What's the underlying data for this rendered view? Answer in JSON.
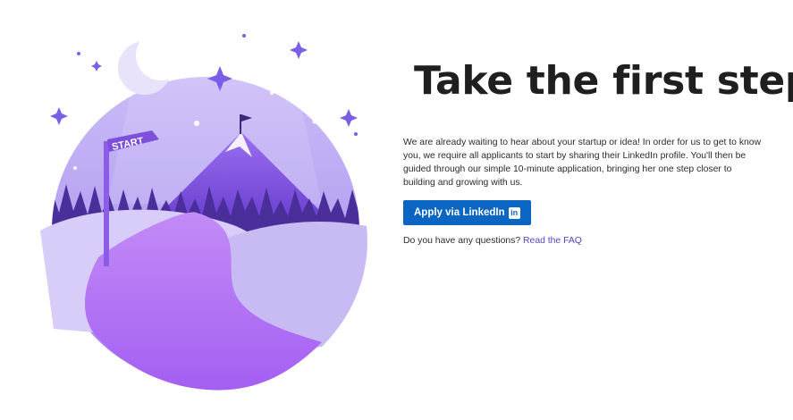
{
  "hero": {
    "title": "Take the first step",
    "description": "We are already waiting to hear about your startup or idea! In order for us to get to know you, we require all applicants to start by sharing their LinkedIn profile. You'll then be guided through our simple 10-minute application, bringing her one step closer to building and growing with us.",
    "apply_label": "Apply via LinkedIn",
    "linkedin_badge": "in",
    "faq_prompt": "Do you have any questions?",
    "faq_link": "Read the FAQ"
  },
  "illustration": {
    "sign_text": "START",
    "icons": [
      "moon-icon",
      "sparkle-star-icon",
      "mountain-flag-icon",
      "signpost-icon"
    ]
  },
  "colors": {
    "button": "#0a66c2",
    "link": "#5b3fc4",
    "title": "#1f1f1f",
    "sky": "#b8a6f2",
    "path": "#b272f5"
  }
}
